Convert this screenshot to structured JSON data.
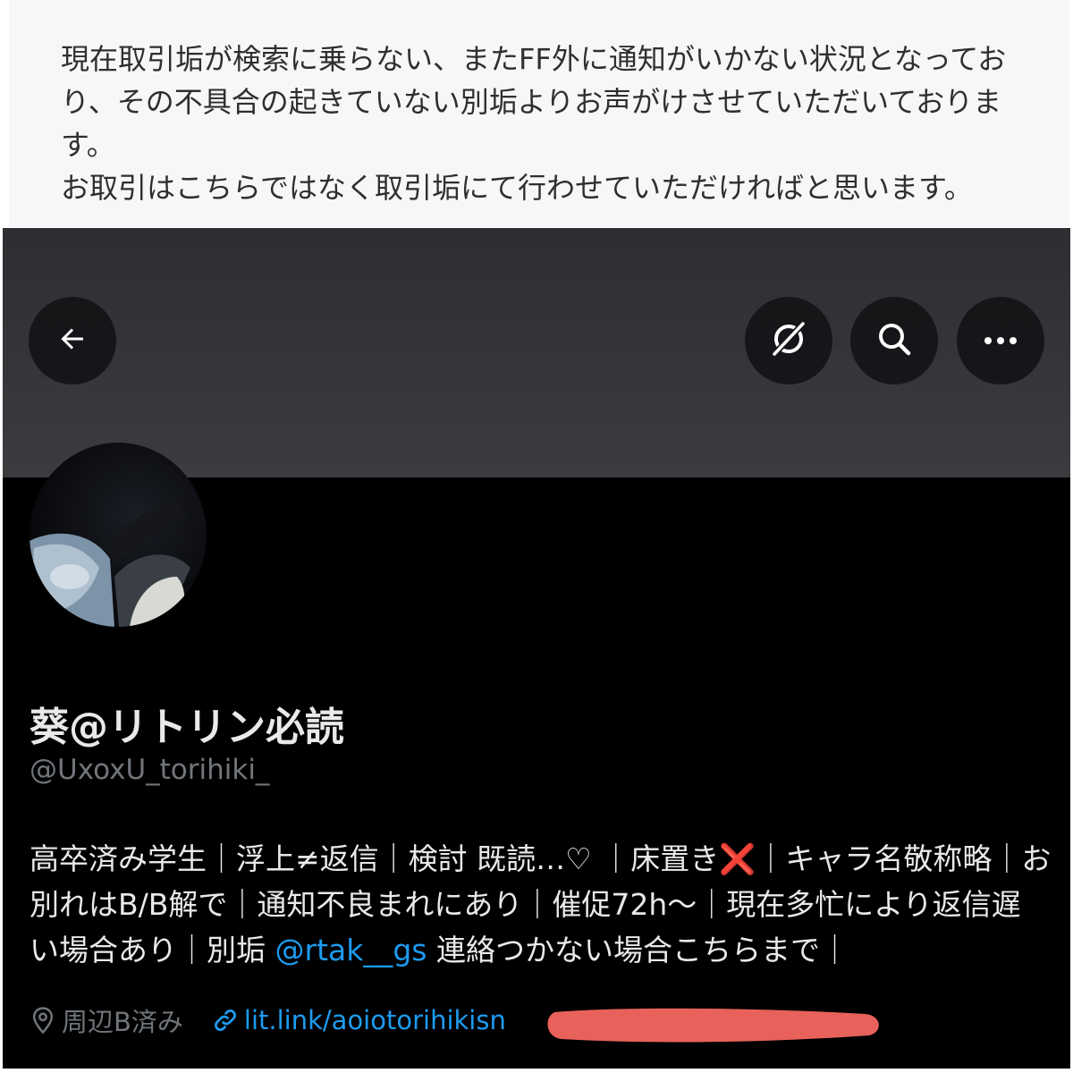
{
  "notice": {
    "lines": [
      "現在取引垢が検索に乗らない、またFF外に通知がいかない状況となってお",
      "り、その不具合の起きていない別垢よりお声がけさせていただいておりま",
      "す。",
      "お取引はこちらではなく取引垢にて行わせていただければと思います。"
    ]
  },
  "header": {
    "back_icon": "arrow-left-icon",
    "grok_icon": "grok-icon",
    "search_icon": "search-icon",
    "more_icon": "more-dots-icon"
  },
  "profile": {
    "display_name": "葵@リトリン必読",
    "handle": "@UxoxU_torihiki_",
    "bio": {
      "line1_a": "高卒済み学生｜浮上≠返信｜検討 既読…♡ ｜床置き",
      "line1_cross": "❌",
      "line1_b": "｜キャラ名敬称略｜お",
      "line2": "別れはB/B解で｜通知不良まれにあり｜催促72h〜｜現在多忙により返信遅",
      "line3_a": "い場合あり｜別垢 ",
      "line3_mention": "@rtak__gs",
      "line3_b": " 連絡つかない場合こちらまで｜"
    },
    "location": "周辺B済み",
    "link": "lit.link/aoiotorihikisn"
  },
  "colors": {
    "accent": "#1d9bf0",
    "redaction": "#e8615a",
    "text": "#e7e9ea",
    "muted": "#71767b"
  }
}
